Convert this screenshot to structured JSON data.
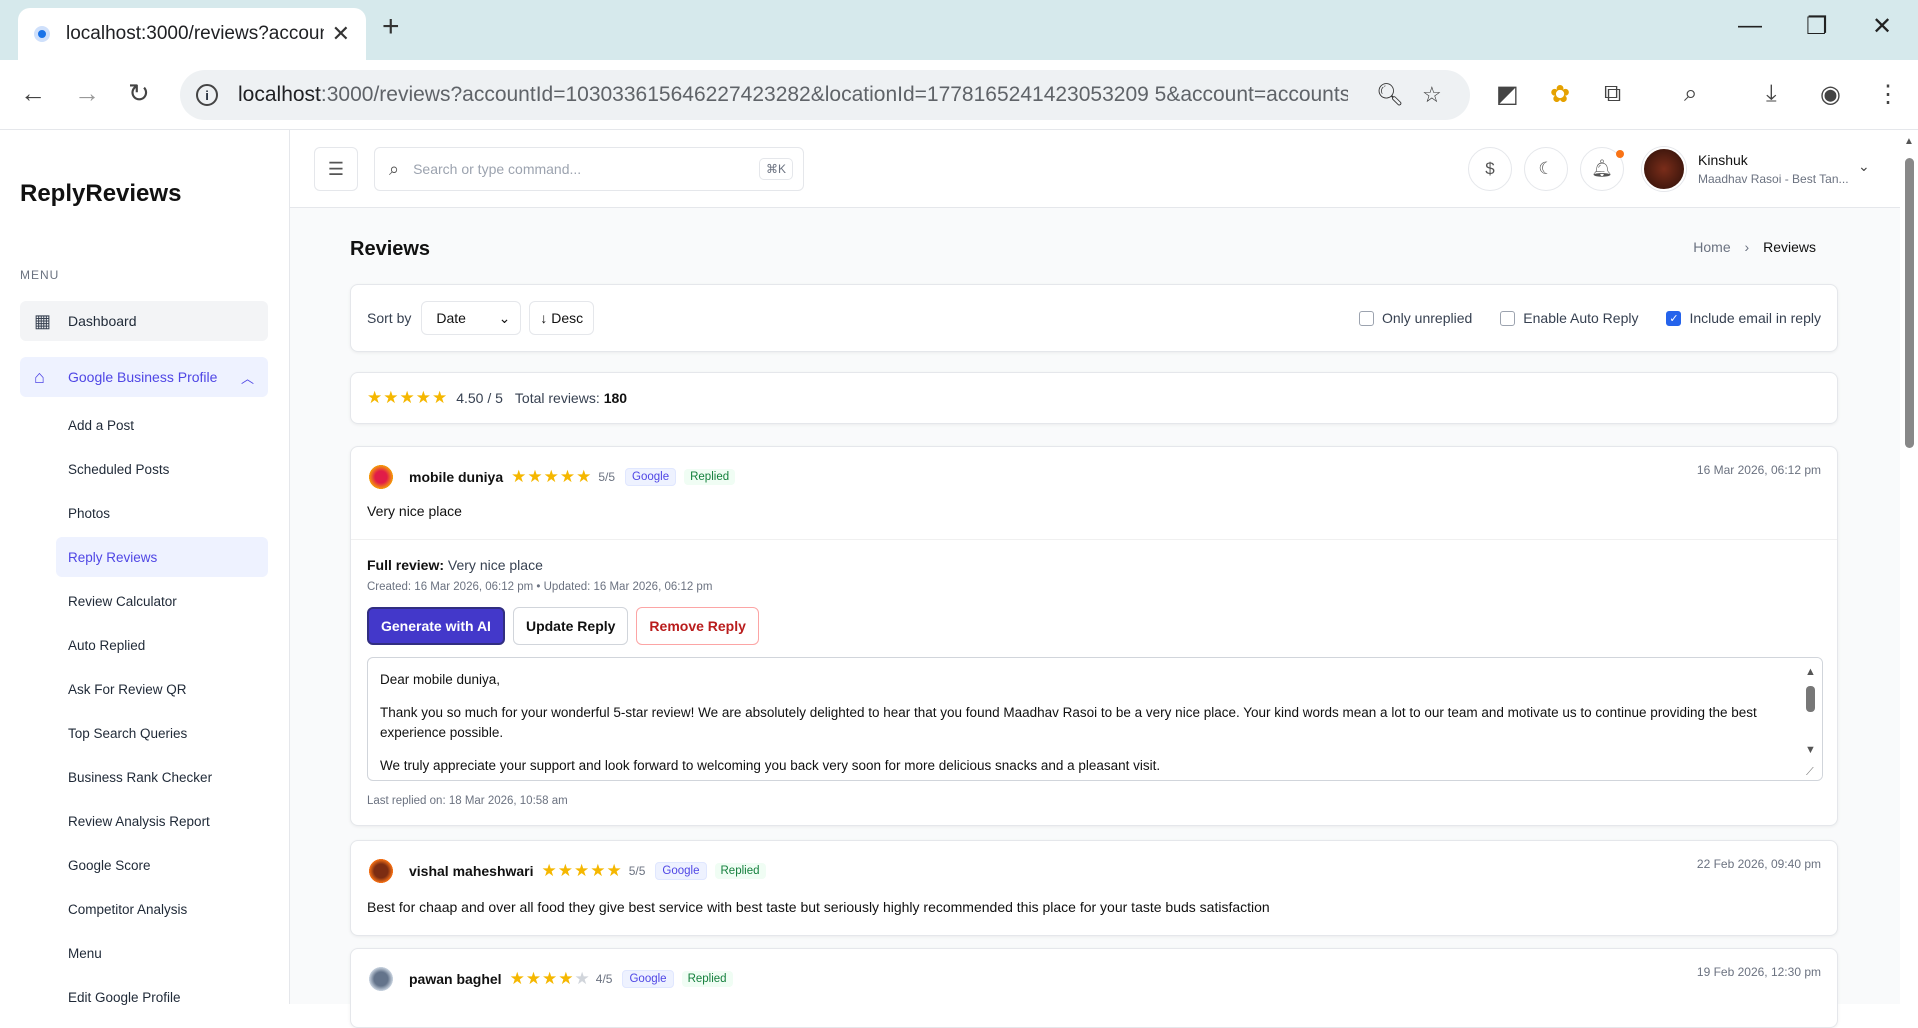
{
  "browser": {
    "tab_title": "localhost:3000/reviews?account",
    "url_host": "localhost",
    "url_rest": ":3000/reviews?accountId=103033615646227423282&locationId=1778165241423053209 5&account=accounts..."
  },
  "sidebar": {
    "brand": "ReplyReviews",
    "menu_heading": "MENU",
    "dashboard": "Dashboard",
    "gbp": "Google Business Profile",
    "sub_items": [
      "Add a Post",
      "Scheduled Posts",
      "Photos",
      "Reply Reviews",
      "Review Calculator",
      "Auto Replied",
      "Ask For Review QR",
      "Top Search Queries",
      "Business Rank Checker",
      "Review Analysis Report",
      "Google Score",
      "Competitor Analysis",
      "Menu",
      "Edit Google Profile"
    ]
  },
  "topbar": {
    "search_placeholder": "Search or type command...",
    "shortcut": "⌘K",
    "user_name": "Kinshuk",
    "user_business": "Maadhav Rasoi - Best Tan..."
  },
  "page": {
    "title": "Reviews",
    "breadcrumb_home": "Home",
    "breadcrumb_current": "Reviews"
  },
  "filters": {
    "sort_label": "Sort by",
    "sort_value": "Date",
    "order": "↓ Desc",
    "only_unreplied": "Only unreplied",
    "auto_reply": "Enable Auto Reply",
    "include_email": "Include email in reply",
    "only_unreplied_checked": false,
    "auto_reply_checked": false,
    "include_email_checked": true
  },
  "summary": {
    "avg": "4.50 / 5",
    "total_label": "Total reviews:",
    "total": "180"
  },
  "reviews": [
    {
      "name": "mobile duniya",
      "rating": "5/5",
      "stars": 5,
      "source": "Google",
      "status": "Replied",
      "date": "16 Mar 2026, 06:12 pm",
      "text": "Very nice place",
      "full_label": "Full review:",
      "full_text": "Very nice place",
      "meta": "Created: 16 Mar 2026, 06:12 pm • Updated: 16 Mar 2026, 06:12 pm",
      "btn_ai": "Generate with AI",
      "btn_update": "Update Reply",
      "btn_remove": "Remove Reply",
      "reply_p1": "Dear mobile duniya,",
      "reply_p2": "Thank you so much for your wonderful 5-star review! We are absolutely delighted to hear that you found Maadhav Rasoi to be a very nice place. Your kind words mean a lot to our team and motivate us to continue providing the best experience possible.",
      "reply_p3": "We truly appreciate your support and look forward to welcoming you back very soon for more delicious snacks and a pleasant visit.",
      "last_replied": "Last replied on: 18 Mar 2026, 10:58 am"
    },
    {
      "name": "vishal maheshwari",
      "rating": "5/5",
      "stars": 5,
      "source": "Google",
      "status": "Replied",
      "date": "22 Feb 2026, 09:40 pm",
      "text": "Best for chaap and over all food they give best service with best taste but seriously highly recommended this place for your taste buds satisfaction"
    },
    {
      "name": "pawan baghel",
      "rating": "4/5",
      "stars": 4,
      "source": "Google",
      "status": "Replied",
      "date": "19 Feb 2026, 12:30 pm"
    }
  ]
}
